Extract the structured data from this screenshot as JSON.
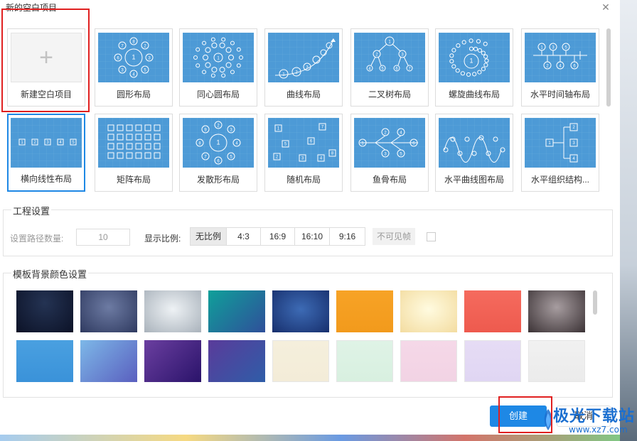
{
  "dialog": {
    "title": "新的空白项目",
    "close_icon": "close-icon"
  },
  "templates": [
    {
      "label": "新建空白项目",
      "kind": "blank"
    },
    {
      "label": "圆形布局",
      "kind": "circle"
    },
    {
      "label": "同心圆布局",
      "kind": "concentric"
    },
    {
      "label": "曲线布局",
      "kind": "curve"
    },
    {
      "label": "二叉树布局",
      "kind": "tree"
    },
    {
      "label": "螺旋曲线布局",
      "kind": "spiral"
    },
    {
      "label": "水平时间轴布局",
      "kind": "timeline"
    },
    {
      "label": "横向线性布局",
      "kind": "linear",
      "selected": true
    },
    {
      "label": "矩阵布局",
      "kind": "matrix"
    },
    {
      "label": "发散形布局",
      "kind": "radial"
    },
    {
      "label": "随机布局",
      "kind": "random"
    },
    {
      "label": "鱼骨布局",
      "kind": "fishbone"
    },
    {
      "label": "水平曲线图布局",
      "kind": "wave"
    },
    {
      "label": "水平组织结构...",
      "kind": "org"
    }
  ],
  "project_settings": {
    "title": "工程设置",
    "path_count_label": "设置路径数量:",
    "path_count_value": "10",
    "ratio_label": "显示比例:",
    "ratio_options": [
      "无比例",
      "4:3",
      "16:9",
      "16:10",
      "9:16"
    ],
    "ratio_selected": "无比例",
    "invisible_frame_label": "不可见帧"
  },
  "bg_colors": {
    "title": "模板背景颜色设置",
    "swatches": [
      "radial-gradient(ellipse at 50% 30%, #243353, #0c1227)",
      "radial-gradient(ellipse at 50% 40%, #6d7ba3, #2f3a60)",
      "radial-gradient(ellipse at 50% 45%, #eef2f5, #a9b2bb)",
      "linear-gradient(135deg, #0fa09a, #2f4f9a)",
      "radial-gradient(ellipse at 50% 45%, #3d6bb5, #172f6d)",
      "linear-gradient(#f7a326, #f29a1c)",
      "radial-gradient(ellipse at 50% 45%, #fffbe0, #f3dca0)",
      "linear-gradient(#f56b5e, #ee5a4e)",
      "radial-gradient(ellipse at 50% 40%, #a79da0, #3b3235)",
      "linear-gradient(#4aa0e0, #3a92d9)",
      "linear-gradient(135deg, #7db8e8, #5a5fbf)",
      "linear-gradient(135deg, #6b3fa0, #2a136a)",
      "linear-gradient(135deg, #5a3b9a, #2f5da8)",
      "linear-gradient(#f5efdc, #f3ecd8)",
      "linear-gradient(#dff3e6, #d8f0e0)",
      "linear-gradient(#f5d8e8, #f2d3e4)",
      "linear-gradient(#e6dcf5, #e0d6f3)",
      "linear-gradient(#f1f1f1, #ebebeb)"
    ]
  },
  "footer": {
    "create_label": "创建",
    "cancel_label": "取消"
  },
  "watermark": {
    "brand": "极光下载站",
    "url": "www.xz7.com"
  }
}
